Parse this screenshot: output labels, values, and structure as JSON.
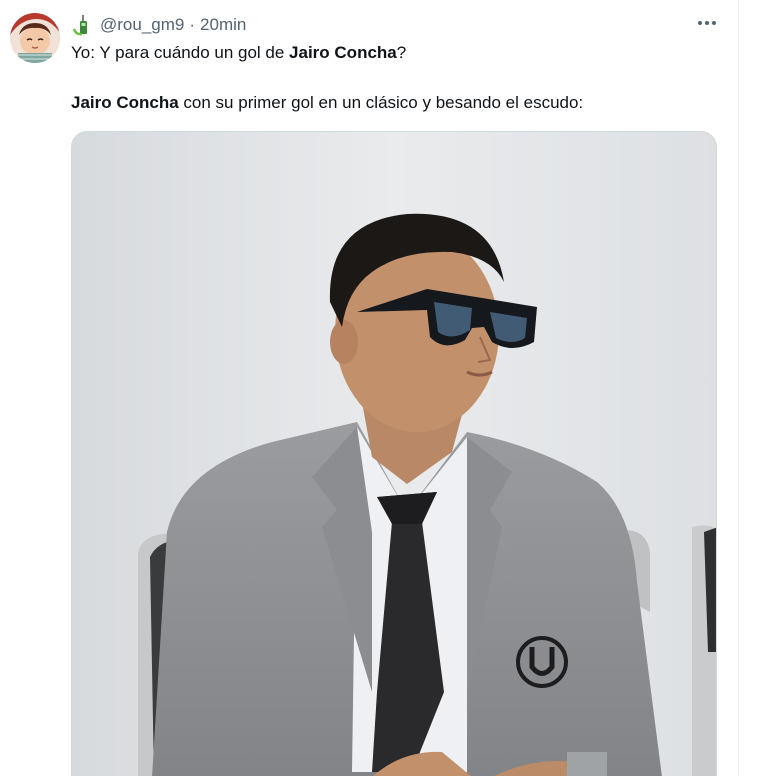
{
  "tweet": {
    "handle": "@rou_gm9",
    "separator": "·",
    "time": "20min",
    "avatar_icon": "avatar-icon",
    "badge_icon": "mobile-phone-icon",
    "more_icon": "more-icon",
    "line1": {
      "prefix": "Yo: Y para cuándo un gol de ",
      "bold": "Jairo Concha",
      "suffix": "?"
    },
    "line2": {
      "bold": "Jairo Concha",
      "suffix": " con su primer gol en un clásico y besando el escudo:"
    }
  },
  "colors": {
    "text": "#0f1419",
    "muted": "#536471",
    "border": "#cfd9de",
    "background": "#ffffff"
  }
}
